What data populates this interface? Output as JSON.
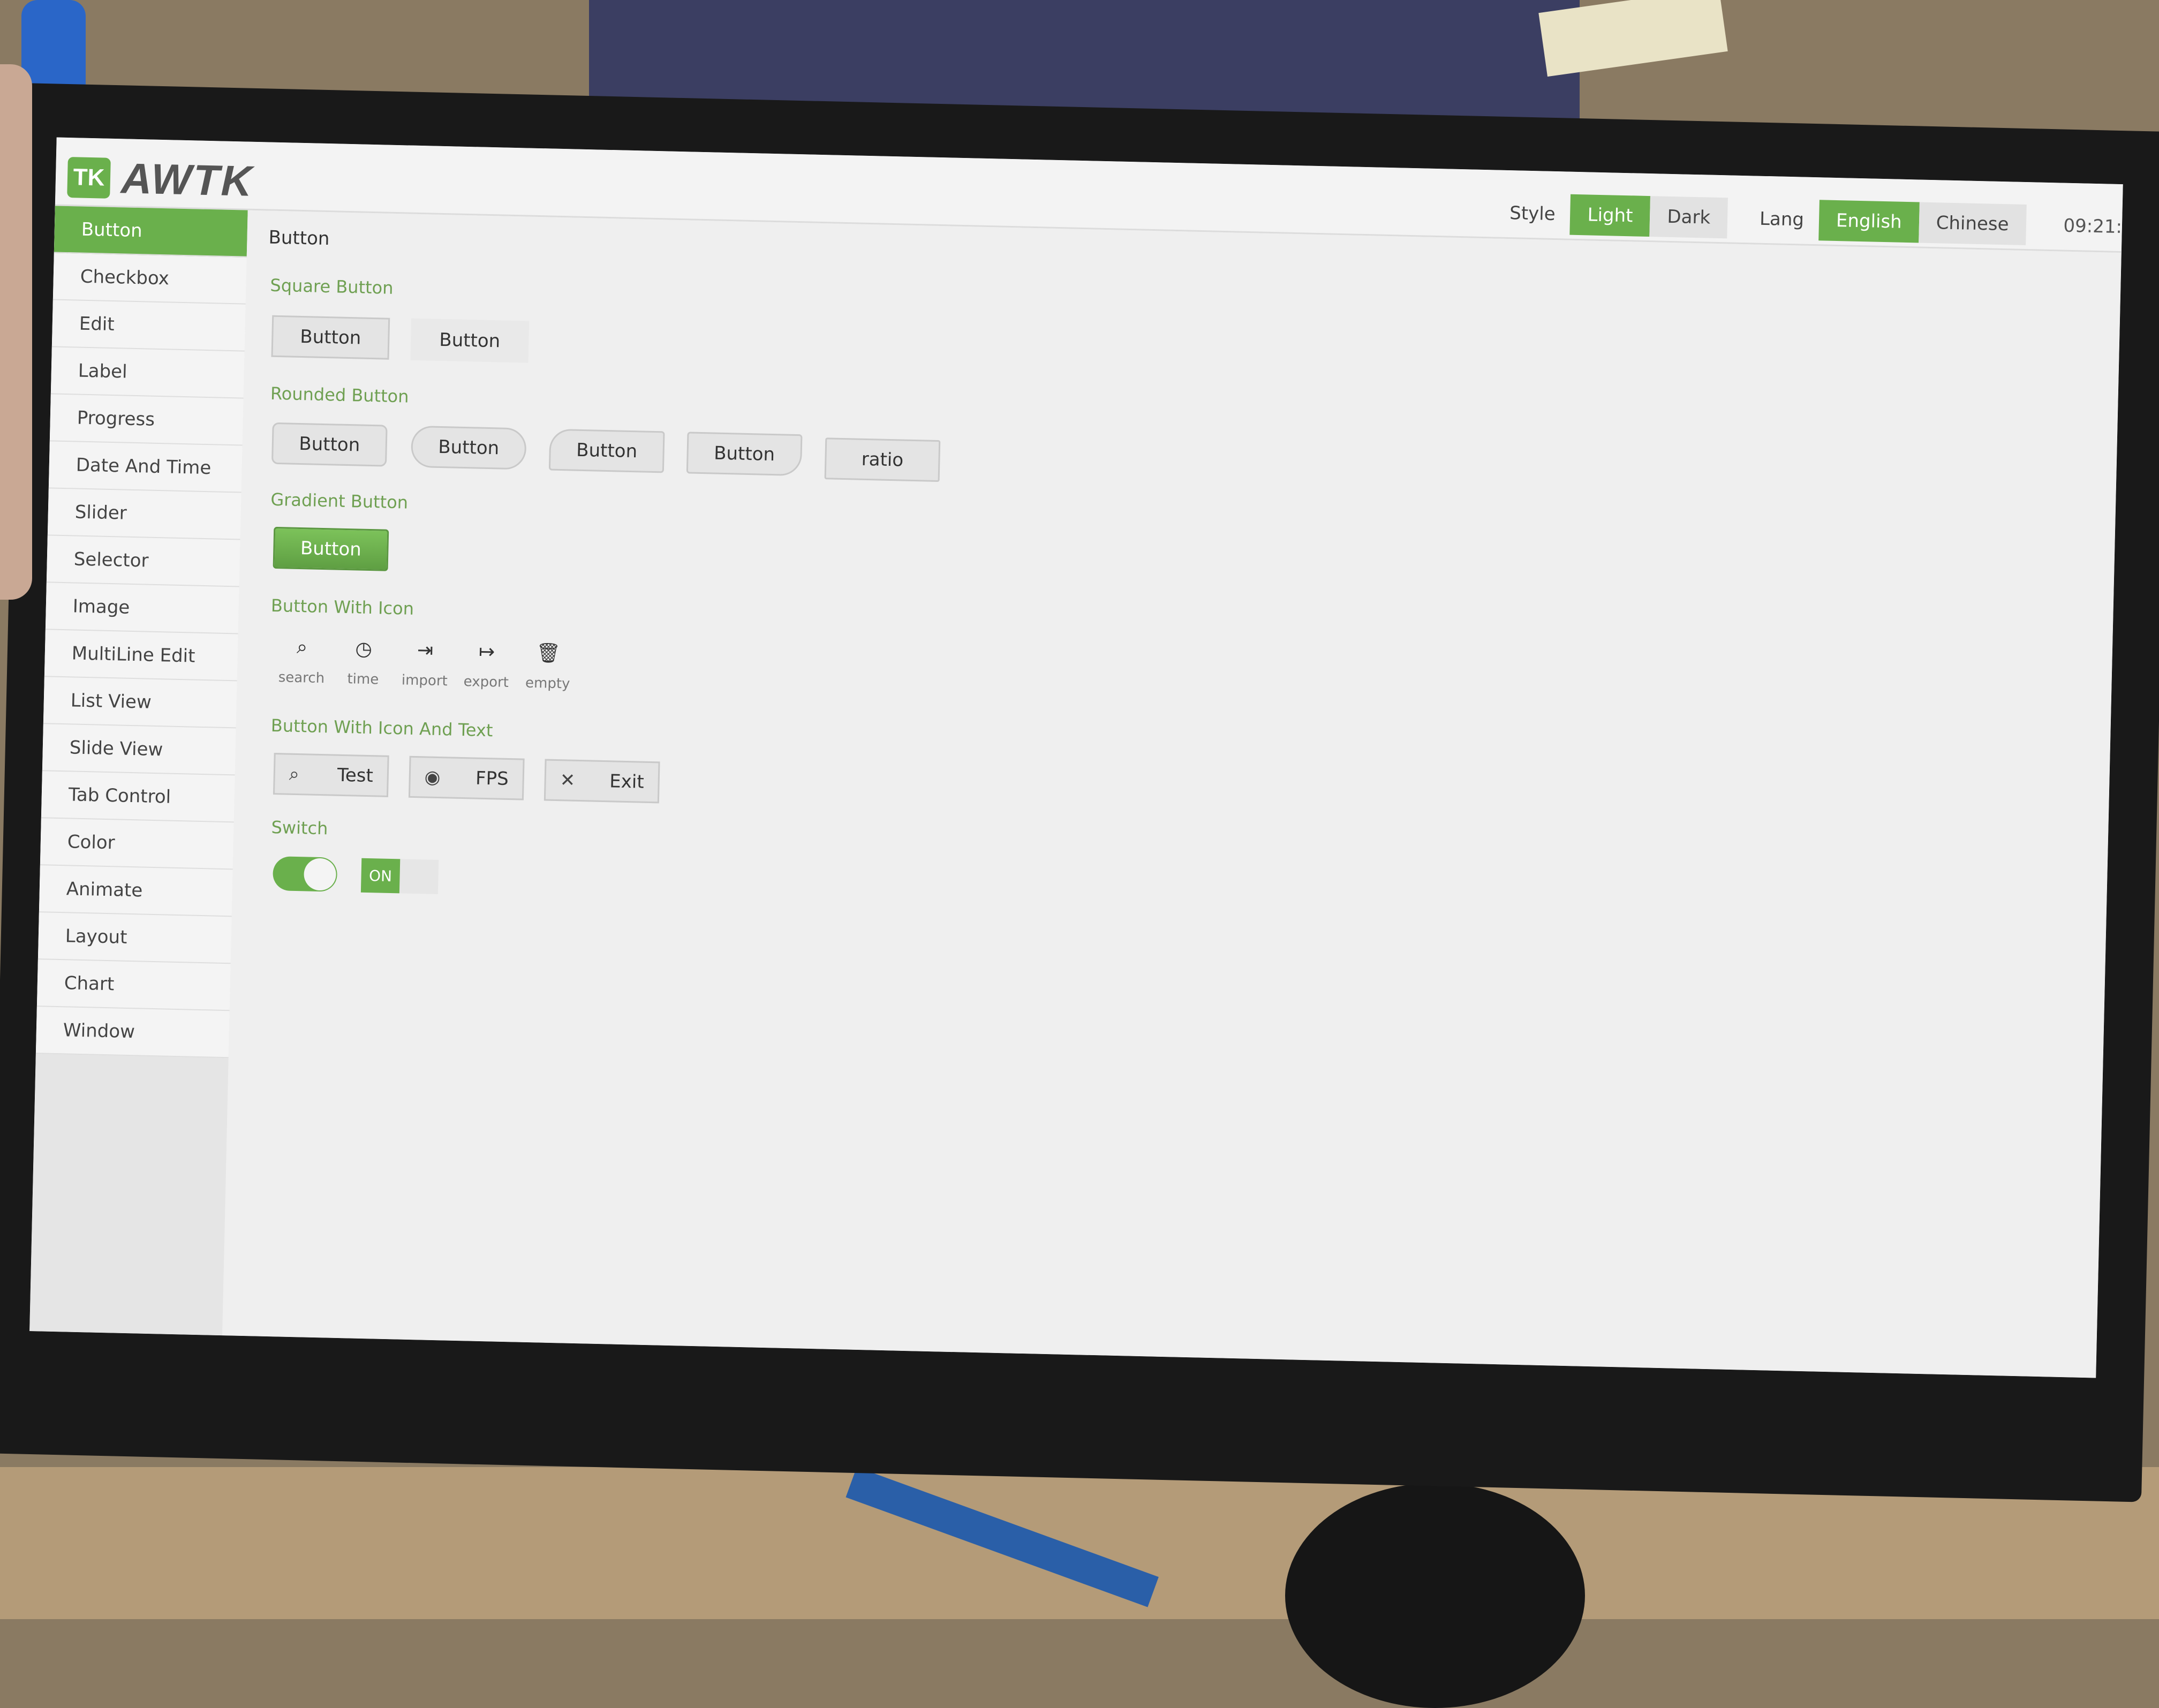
{
  "app": {
    "logo_mark": "TK",
    "logo_text": "AWTK"
  },
  "topbar": {
    "style_label": "Style",
    "style_options": [
      "Light",
      "Dark"
    ],
    "style_selected": "Light",
    "lang_label": "Lang",
    "lang_options": [
      "English",
      "Chinese"
    ],
    "lang_selected": "English",
    "clock": "09:21:"
  },
  "sidebar": {
    "items": [
      {
        "label": "Button",
        "active": true
      },
      {
        "label": "Checkbox"
      },
      {
        "label": "Edit"
      },
      {
        "label": "Label"
      },
      {
        "label": "Progress"
      },
      {
        "label": "Date And Time"
      },
      {
        "label": "Slider"
      },
      {
        "label": "Selector"
      },
      {
        "label": "Image"
      },
      {
        "label": "MultiLine Edit"
      },
      {
        "label": "List View"
      },
      {
        "label": "Slide View"
      },
      {
        "label": "Tab Control"
      },
      {
        "label": "Color"
      },
      {
        "label": "Animate"
      },
      {
        "label": "Layout"
      },
      {
        "label": "Chart"
      },
      {
        "label": "Window"
      }
    ]
  },
  "main": {
    "title": "Button",
    "square": {
      "label": "Square Button",
      "buttons": [
        "Button",
        "Button"
      ]
    },
    "rounded": {
      "label": "Rounded Button",
      "buttons": [
        "Button",
        "Button",
        "Button",
        "Button",
        "ratio"
      ]
    },
    "gradient": {
      "label": "Gradient Button",
      "button": "Button"
    },
    "with_icon": {
      "label": "Button With Icon",
      "buttons": [
        {
          "caption": "search",
          "icon": "search-icon"
        },
        {
          "caption": "time",
          "icon": "clock-icon"
        },
        {
          "caption": "import",
          "icon": "import-icon"
        },
        {
          "caption": "export",
          "icon": "export-icon"
        },
        {
          "caption": "empty",
          "icon": "trash-icon"
        }
      ]
    },
    "icon_text": {
      "label": "Button With Icon And Text",
      "buttons": [
        {
          "text": "Test",
          "icon": "search-icon"
        },
        {
          "text": "FPS",
          "icon": "eye-icon"
        },
        {
          "text": "Exit",
          "icon": "close-icon"
        }
      ]
    },
    "switch": {
      "label": "Switch",
      "switch1_on": true,
      "switch2_text": "ON"
    }
  },
  "colors": {
    "accent": "#6ab04c",
    "label_green": "#6fa052"
  }
}
